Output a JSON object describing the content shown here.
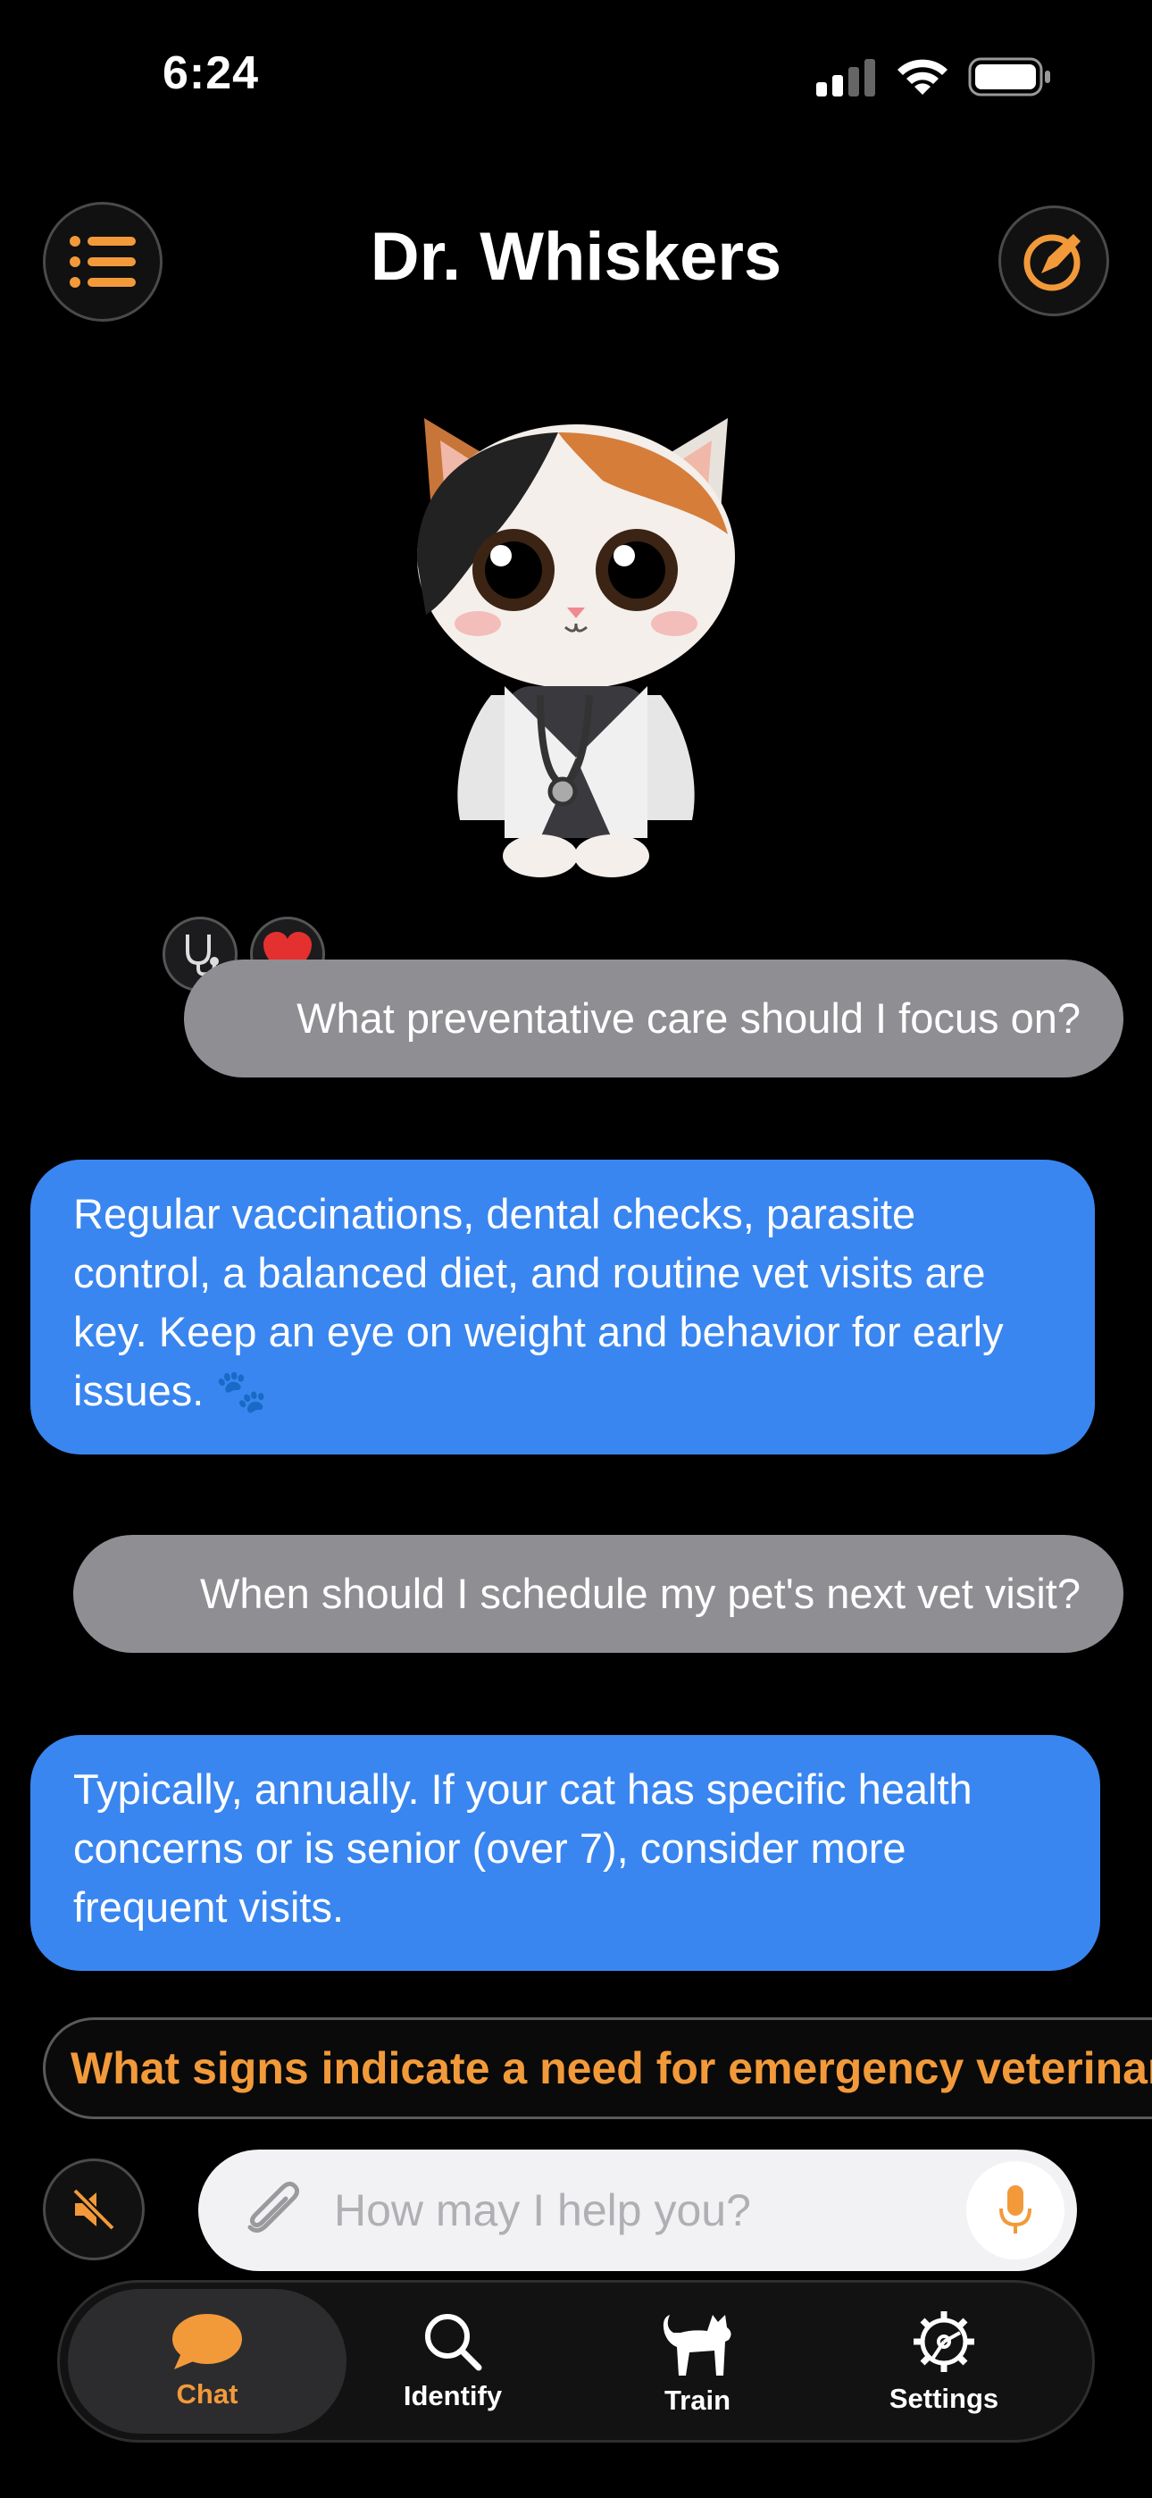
{
  "status_bar": {
    "time": "6:24"
  },
  "header": {
    "title": "Dr. Whiskers",
    "menu_icon": "list-icon",
    "compose_icon": "compass-edit-icon"
  },
  "avatar": {
    "description_icon": "cat-doctor-avatar"
  },
  "reactions": [
    "stethoscope-icon",
    "heart-icon"
  ],
  "messages": [
    {
      "role": "user",
      "text": "What preventative care should I focus on?"
    },
    {
      "role": "assistant",
      "text": "Regular vaccinations, dental checks, parasite control, a balanced diet, and routine vet visits are key. Keep an eye on weight and behavior for early issues. 🐾"
    },
    {
      "role": "user",
      "text": "When should I schedule my pet's next vet visit?"
    },
    {
      "role": "assistant",
      "text": "Typically, annually. If your cat has specific health concerns or is senior (over 7), consider more frequent visits."
    }
  ],
  "suggestion": {
    "text": "What signs indicate a need for emergency veterinary care?"
  },
  "composer": {
    "placeholder": "How may I help you?",
    "value": ""
  },
  "tabs": [
    {
      "label": "Chat",
      "icon": "chat-bubble-icon",
      "active": true
    },
    {
      "label": "Identify",
      "icon": "search-icon",
      "active": false
    },
    {
      "label": "Train",
      "icon": "cat-icon",
      "active": false
    },
    {
      "label": "Settings",
      "icon": "gear-icon",
      "active": false
    }
  ],
  "colors": {
    "accent": "#f29a3a",
    "assistant_bubble": "#3a86f0",
    "user_bubble": "#8e8e93",
    "background": "#000000"
  }
}
